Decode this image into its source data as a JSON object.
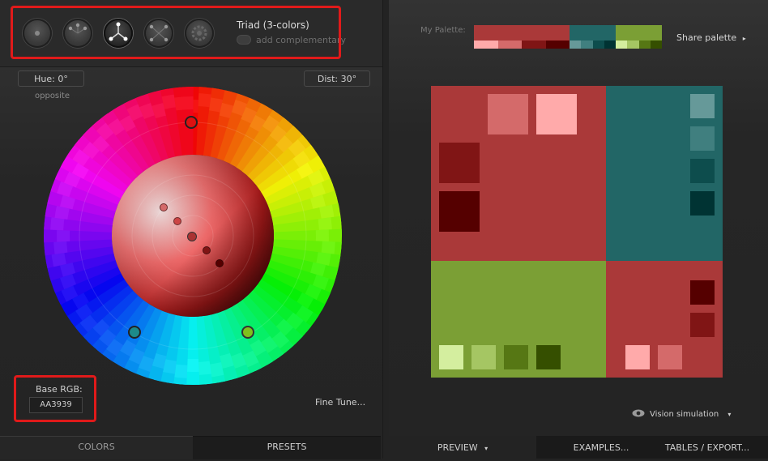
{
  "scheme": {
    "buttons": [
      {
        "name": "mono-scheme-icon",
        "active": false
      },
      {
        "name": "adjacent-scheme-icon",
        "active": false
      },
      {
        "name": "triad-scheme-icon",
        "active": true
      },
      {
        "name": "tetrad-scheme-icon",
        "active": false
      },
      {
        "name": "custom-scheme-icon",
        "active": false
      }
    ],
    "mode_label": "Triad (3-colors)",
    "complementary_label": "add complementary"
  },
  "wheel": {
    "hue_label": "Hue: 0°",
    "hue_sub": "opposite",
    "dist_label": "Dist: 30°"
  },
  "base": {
    "label": "Base RGB:",
    "value": "AA3939"
  },
  "fine_tune": "Fine Tune...",
  "left_tabs": {
    "colors": "COLORS",
    "presets": "PRESETS"
  },
  "palette": {
    "label": "My Palette:",
    "share": "Share palette",
    "share_arrow": "▸",
    "groups": [
      {
        "main": "#AA3939",
        "shades": [
          "#FFAAAA",
          "#D46A6A",
          "#801515",
          "#550000"
        ]
      },
      {
        "main": "#226666",
        "shades": [
          "#669999",
          "#407F7F",
          "#0D4D4D",
          "#003333"
        ]
      },
      {
        "main": "#7B9F35",
        "shades": [
          "#D4EE9F",
          "#A5C663",
          "#567714",
          "#354F00"
        ]
      }
    ]
  },
  "vision": {
    "label": "Vision simulation",
    "arrow": "▾"
  },
  "right_tabs": {
    "preview": "PREVIEW",
    "preview_arrow": "▾",
    "examples": "EXAMPLES...",
    "tables": "TABLES / EXPORT..."
  }
}
